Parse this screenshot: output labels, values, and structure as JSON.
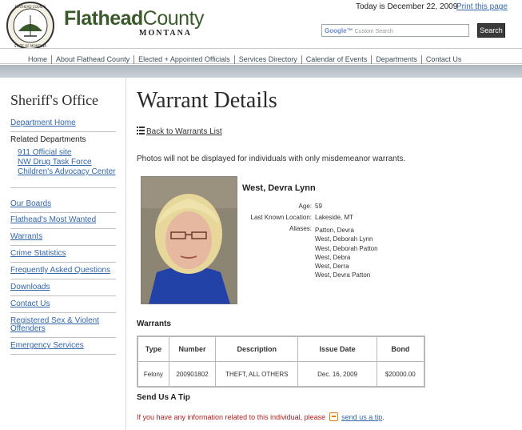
{
  "header": {
    "seal_text": "SEAL OF FLATHEAD COUNTY · STATE OF MONTANA",
    "logo_word1": "Flathead",
    "logo_word2": "County",
    "logo_sub": "MONTANA",
    "today": "Today is December 22, 2009",
    "print_link": "Print this page",
    "search_placeholder": "Custom Search",
    "search_brand": "Google™",
    "search_button": "Search"
  },
  "nav": {
    "items": [
      "Home",
      "About Flathead  County",
      "Elected + Appointed Officials",
      "Services Directory",
      "Calendar of Events",
      "Departments",
      "Contact Us"
    ]
  },
  "sidebar": {
    "title": "Sheriff's Office",
    "department_home": "Department Home",
    "related_label": "Related Departments",
    "related": [
      "911 Official site",
      "NW Drug Task Force",
      "Children's Advocacy Center"
    ],
    "links": [
      "Our Boards",
      "Flathead's Most Wanted",
      "Warrants",
      "Crime Statistics",
      "Frequently Asked Questions",
      "Downloads",
      "Contact Us",
      "Registered Sex & Violent Offenders",
      "Emergency Services"
    ]
  },
  "main": {
    "title": "Warrant Details",
    "back_link": "Back to Warrants List",
    "note": "Photos will not be displayed for individuals with only misdemeanor warrants.",
    "person": {
      "name": "West, Devra Lynn",
      "age_label": "Age:",
      "age": "59",
      "location_label": "Last Known Location:",
      "location": "Lakeside, MT",
      "aliases_label": "Aliases:",
      "aliases": [
        "Patton, Devra",
        "West, Deborah Lynn",
        "West, Deborah Patton",
        "West, Debra",
        "West, Derra",
        "West, Devra Patton"
      ]
    },
    "warrants_heading": "Warrants",
    "warrants_table": {
      "columns": [
        "Type",
        "Number",
        "Description",
        "Issue Date",
        "Bond"
      ],
      "rows": [
        [
          "Felony",
          "200901802",
          "THEFT, ALL OTHERS",
          "Dec. 16, 2009",
          "$20000.00"
        ]
      ]
    },
    "tip_heading": "Send Us A Tip",
    "tip_text": "If you have any information related to this individual, please",
    "tip_link": "send us a tip",
    "tip_end": "."
  },
  "colors": {
    "logo_green": "#3a5a2c",
    "link_blue": "#3366aa",
    "tip_red": "#b22222",
    "band_gray": "#aeb8bf"
  }
}
